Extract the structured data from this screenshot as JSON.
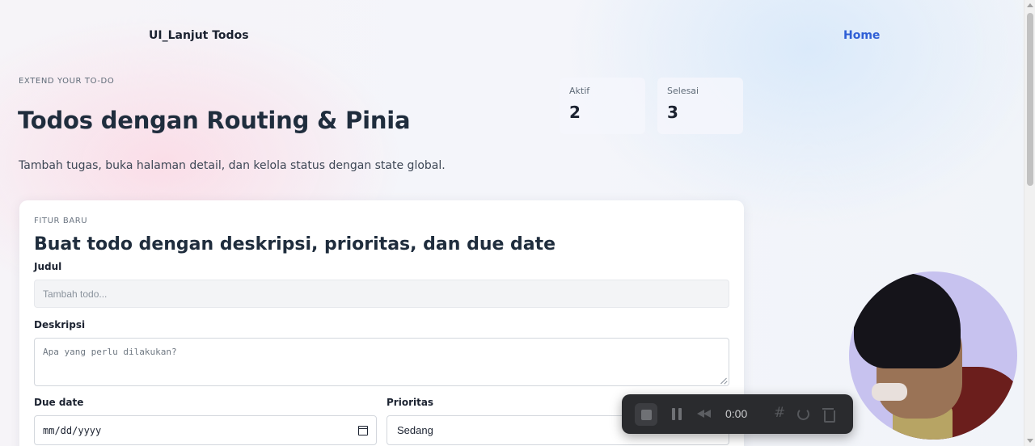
{
  "nav": {
    "brand": "UI_Lanjut Todos",
    "home": "Home"
  },
  "hero": {
    "eyebrow": "EXTEND YOUR TO-DO",
    "title": "Todos dengan Routing & Pinia",
    "subtitle": "Tambah tugas, buka halaman detail, dan kelola status dengan state global."
  },
  "stats": {
    "active_label": "Aktif",
    "active_value": "2",
    "done_label": "Selesai",
    "done_value": "3"
  },
  "form": {
    "eyebrow": "FITUR BARU",
    "title": "Buat todo dengan deskripsi, prioritas, dan due date",
    "title_label": "Judul",
    "title_placeholder": "Tambah todo...",
    "description_label": "Deskripsi",
    "description_placeholder": "Apa yang perlu dilakukan?",
    "due_label": "Due date",
    "due_value": "mm/dd/yyyy",
    "priority_label": "Prioritas",
    "priority_value": "Sedang"
  },
  "recorder": {
    "time": "0:00"
  },
  "colors": {
    "accent": "#2f5fd6",
    "text": "#1f2d3d",
    "card": "#ffffff",
    "recorder_bg": "#2a2b2e"
  }
}
